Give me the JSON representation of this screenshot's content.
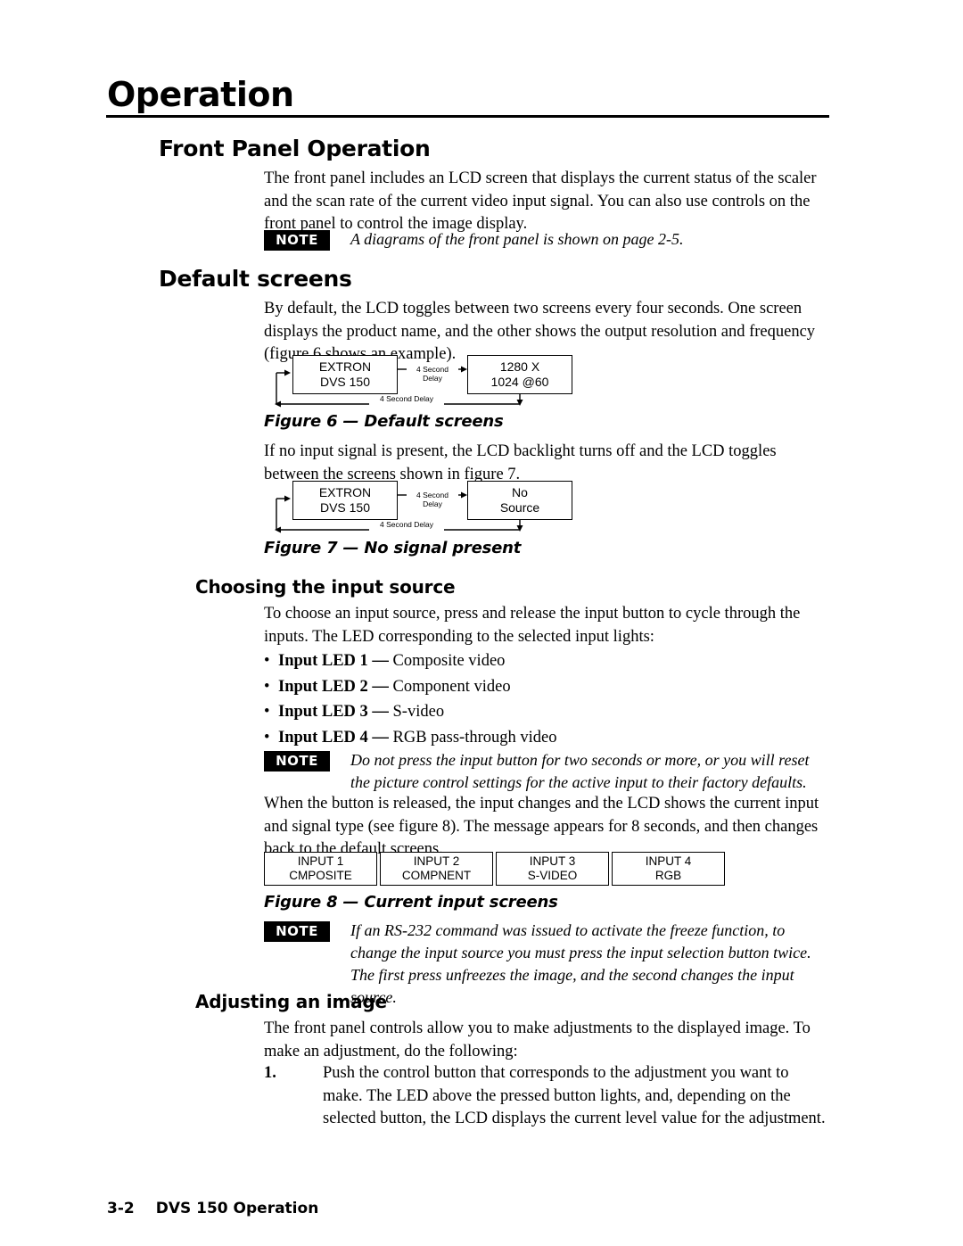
{
  "document": {
    "chapter_title": "Operation"
  },
  "sections": {
    "front_panel": {
      "heading": "Front Panel Operation",
      "paragraph": "The front panel includes an LCD screen that displays the current status of the scaler and the scan rate of the current video input signal.  You can also use controls on the front panel to control the image display.",
      "note": {
        "badge": "NOTE",
        "text": "A diagrams of the front panel is shown on page 2-5."
      }
    },
    "default_screens": {
      "heading": "Default screens",
      "paragraph": "By default, the  LCD toggles between two screens every four seconds.  One screen displays the product name, and the other shows the output resolution and frequency (figure 6 shows an example).",
      "figure6": {
        "caption": "Figure 6 — Default screens",
        "left_screen": {
          "line1": "EXTRON",
          "line2": "DVS 150"
        },
        "right_screen": {
          "line1": "1280 X",
          "line2": "1024   @60"
        },
        "delay_top": "4 Second Delay",
        "delay_bottom": "4 Second Delay"
      },
      "paragraph2": "If no input signal is present, the LCD backlight turns off and the LCD toggles between the screens shown in figure 7.",
      "figure7": {
        "caption": "Figure 7 — No signal present",
        "left_screen": {
          "line1": "EXTRON",
          "line2": "DVS 150"
        },
        "right_screen": {
          "line1": "No",
          "line2": "Source"
        },
        "delay_top": "4 Second Delay",
        "delay_bottom": "4 Second Delay"
      }
    },
    "choosing_input": {
      "heading": "Choosing the input source",
      "paragraph": "To choose an input source, press and release the input button to cycle through the inputs.  The LED corresponding to the selected input lights:",
      "bullets": [
        {
          "label": "Input LED 1",
          "dash": " — ",
          "text": "Composite video"
        },
        {
          "label": "Input LED 2",
          "dash": " — ",
          "text": "Component video"
        },
        {
          "label": "Input LED 3",
          "dash": " — ",
          "text": "S-video"
        },
        {
          "label": "Input LED 4",
          "dash": " — ",
          "text": "RGB pass-through video"
        }
      ],
      "note": {
        "badge": "NOTE",
        "text": "Do not press the input button for two seconds or more, or you will reset the picture control settings for the active input to their factory defaults."
      },
      "paragraph2": "When the button is released, the input changes and the LCD shows the current input and signal type (see figure 8).  The message appears for 8 seconds, and then changes back to the default screens.",
      "figure8": {
        "caption": "Figure 8 — Current input screens",
        "screens": [
          {
            "line1": "INPUT 1",
            "line2": "CMPOSITE"
          },
          {
            "line1": "INPUT 2",
            "line2": "COMPNENT"
          },
          {
            "line1": "INPUT 3",
            "line2": "S-VIDEO"
          },
          {
            "line1": "INPUT 4",
            "line2": "RGB"
          }
        ]
      },
      "note2": {
        "badge": "NOTE",
        "text": "If an RS-232 command was issued to activate the freeze function, to change the input source you must press the input selection button twice.  The first press unfreezes the image, and the second changes the input source."
      }
    },
    "adjusting_image": {
      "heading": "Adjusting an image",
      "paragraph": "The front panel controls allow you to make adjustments to the displayed image.  To make an adjustment, do the following:",
      "steps": [
        {
          "number": "1.",
          "text": "Push the control button that corresponds to the adjustment you want to make.  The LED above the pressed button lights, and, depending on the selected button, the LCD displays the current level value for the adjustment."
        }
      ]
    }
  },
  "footer": {
    "page_number": "3-2",
    "title": "DVS 150 Operation"
  }
}
